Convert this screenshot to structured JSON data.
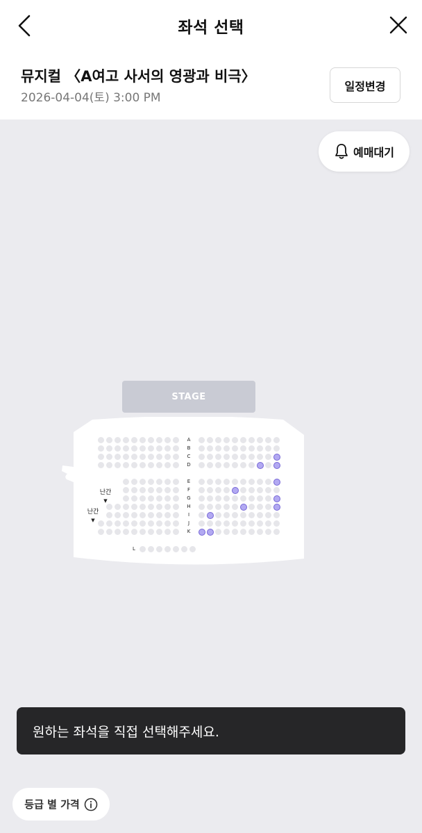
{
  "header": {
    "title": "좌석 선택",
    "back_icon": "chevron-left-icon",
    "close_icon": "close-icon"
  },
  "show": {
    "title": "뮤지컬 〈A여고 사서의 영광과 비극〉",
    "datetime": "2026-04-04(토) 3:00 PM",
    "change_schedule_label": "일정변경"
  },
  "waitlist": {
    "label": "예매대기",
    "icon": "bell-icon"
  },
  "seatmap": {
    "stage_label": "STAGE",
    "row_labels": [
      "A",
      "B",
      "C",
      "D",
      "E",
      "F",
      "G",
      "H",
      "I",
      "J",
      "K",
      "L"
    ],
    "railing_labels": [
      "난간",
      "난간"
    ],
    "selected_color": "#b2a9f2",
    "seat_color": "#e6e6ea",
    "highlighted_seats": [
      {
        "row": "C",
        "col": 9
      },
      {
        "row": "D",
        "col": 7
      },
      {
        "row": "D",
        "col": 9
      },
      {
        "row": "E",
        "col": 9
      },
      {
        "row": "F",
        "col": 4
      },
      {
        "row": "G",
        "col": 9
      },
      {
        "row": "H",
        "col": 5
      },
      {
        "row": "H",
        "col": 9
      },
      {
        "row": "I",
        "col": 1
      },
      {
        "row": "K",
        "col": 0
      },
      {
        "row": "K",
        "col": 1
      }
    ]
  },
  "toast": {
    "message": "원하는 좌석을 직접 선택해주세요."
  },
  "footer": {
    "price_label": "등급 별 가격",
    "info_icon": "info-icon"
  }
}
